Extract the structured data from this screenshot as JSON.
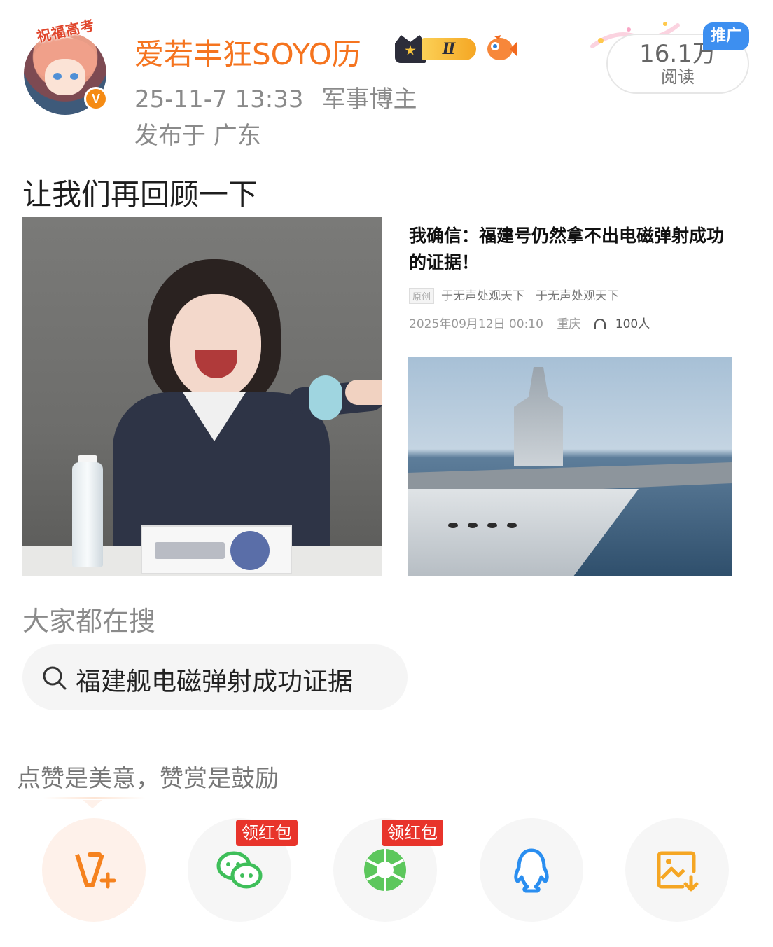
{
  "author": {
    "avatar_ribbon": "祝福高考",
    "verified_badge": "V",
    "name": "爱若丰狂SOYO历",
    "vip_level": "Ⅱ",
    "post_time": "25-11-7 13:33",
    "tag": "军事博主",
    "location": "发布于 广东"
  },
  "stats": {
    "reads_count": "16.1万",
    "reads_label": "阅读",
    "promo_label": "推广"
  },
  "post": {
    "text": "让我们再回顾一下",
    "left_image_icon": "image-icon",
    "article": {
      "title": "我确信：福建号仍然拿不出电磁弹射成功的证据！",
      "original_tag": "原创",
      "author_1": "于无声处观天下",
      "author_2": "于无声处观天下",
      "date": "2025年09月12日 00:10",
      "region": "重庆",
      "listeners": "100人"
    }
  },
  "search": {
    "section_title": "大家都在搜",
    "query": "福建舰电磁弹射成功证据"
  },
  "tip": "点赞是美意，赞赏是鼓励",
  "share": {
    "red_packet_label": "领红包",
    "buttons": [
      {
        "id": "reward",
        "icon": "v-plus-icon",
        "color": "#f5821f"
      },
      {
        "id": "wechat",
        "icon": "wechat-icon",
        "color": "#3fbf5a"
      },
      {
        "id": "moments",
        "icon": "moments-icon",
        "color": "#5cc75c"
      },
      {
        "id": "qq",
        "icon": "qq-icon",
        "color": "#2a8ef0"
      },
      {
        "id": "save-image",
        "icon": "save-image-icon",
        "color": "#f5a623"
      }
    ]
  },
  "colors": {
    "username": "#f5741f",
    "verified": "#f58b14",
    "promo": "#3d8ff0",
    "red_packet": "#e8342b"
  }
}
